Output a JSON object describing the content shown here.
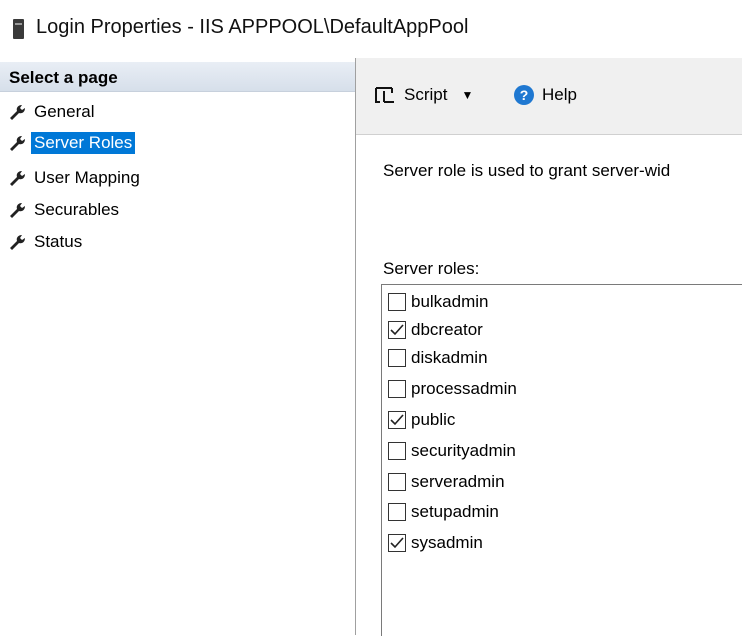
{
  "window": {
    "title": "Login Properties - IIS APPPOOL\\DefaultAppPool"
  },
  "left_pane": {
    "header": "Select a page",
    "items": [
      {
        "label": "General",
        "selected": false,
        "icon": "wrench-icon"
      },
      {
        "label": "Server Roles",
        "selected": true,
        "icon": "wrench-icon"
      },
      {
        "label": "User Mapping",
        "selected": false,
        "icon": "wrench-icon"
      },
      {
        "label": "Securables",
        "selected": false,
        "icon": "wrench-icon"
      },
      {
        "label": "Status",
        "selected": false,
        "icon": "wrench-icon"
      }
    ]
  },
  "toolbar": {
    "script_label": "Script",
    "help_label": "Help"
  },
  "content": {
    "description": "Server role is used to grant server-wid",
    "roles_label": "Server roles:",
    "roles": [
      {
        "name": "bulkadmin",
        "checked": false
      },
      {
        "name": "dbcreator",
        "checked": true
      },
      {
        "name": "diskadmin",
        "checked": false
      },
      {
        "name": "processadmin",
        "checked": false
      },
      {
        "name": "public",
        "checked": true
      },
      {
        "name": "securityadmin",
        "checked": false
      },
      {
        "name": "serveradmin",
        "checked": false
      },
      {
        "name": "setupadmin",
        "checked": false
      },
      {
        "name": "sysadmin",
        "checked": true
      }
    ]
  },
  "colors": {
    "selection": "#0078d7",
    "help_icon": "#1f78d1"
  }
}
